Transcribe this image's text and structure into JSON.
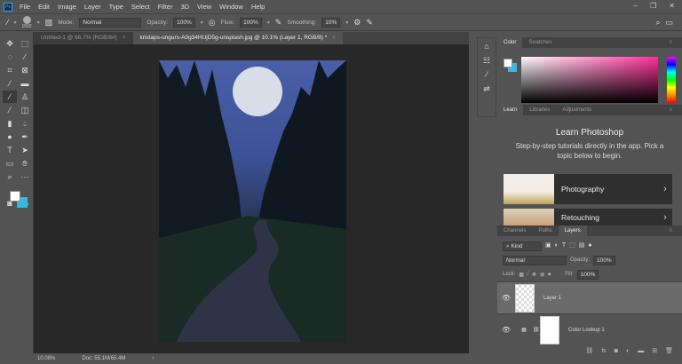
{
  "app": {
    "logo": "Ps"
  },
  "menu": [
    "File",
    "Edit",
    "Image",
    "Layer",
    "Type",
    "Select",
    "Filter",
    "3D",
    "View",
    "Window",
    "Help"
  ],
  "window_controls": {
    "minimize": "–",
    "restore": "❐",
    "close": "✕"
  },
  "options": {
    "brush_size": "1502",
    "mode_label": "Mode:",
    "mode": "Normal",
    "opacity_label": "Opacity:",
    "opacity": "100%",
    "flow_label": "Flow:",
    "flow": "100%",
    "smoothing_label": "Smoothing:",
    "smoothing": "10%"
  },
  "doc_tabs": [
    {
      "label": "Untitled-1 @ 66.7% (RGB/8#)",
      "close": "×"
    },
    {
      "label": "kristaps-ungurs-A0g34HUjD5g-unsplash.jpg @ 10.1% (Layer 1, RGB/8) *",
      "close": "×"
    }
  ],
  "status": {
    "zoom": "10.08%",
    "doc": "Doc: 55.1M/65.4M",
    "arrow": "›"
  },
  "color_panel": {
    "tabs": [
      "Color",
      "Swatches"
    ]
  },
  "learn_panel": {
    "tabs": [
      "Learn",
      "Libraries",
      "Adjustments"
    ],
    "title": "Learn Photoshop",
    "subtitle": "Step-by-step tutorials directly in the app. Pick a topic below to begin.",
    "cards": [
      "Photography",
      "Retouching"
    ]
  },
  "layers_panel": {
    "tabs": [
      "Channels",
      "Paths",
      "Layers"
    ],
    "filter": "Kind",
    "blend": "Normal",
    "opacity_label": "Opacity:",
    "opacity": "100%",
    "lock_label": "Lock:",
    "fill_label": "Fill:",
    "fill": "100%",
    "layers": [
      "Layer 1",
      "Color Lookup 1"
    ]
  },
  "colors": {
    "foreground": "#ffffff",
    "background": "#36b8e0"
  }
}
